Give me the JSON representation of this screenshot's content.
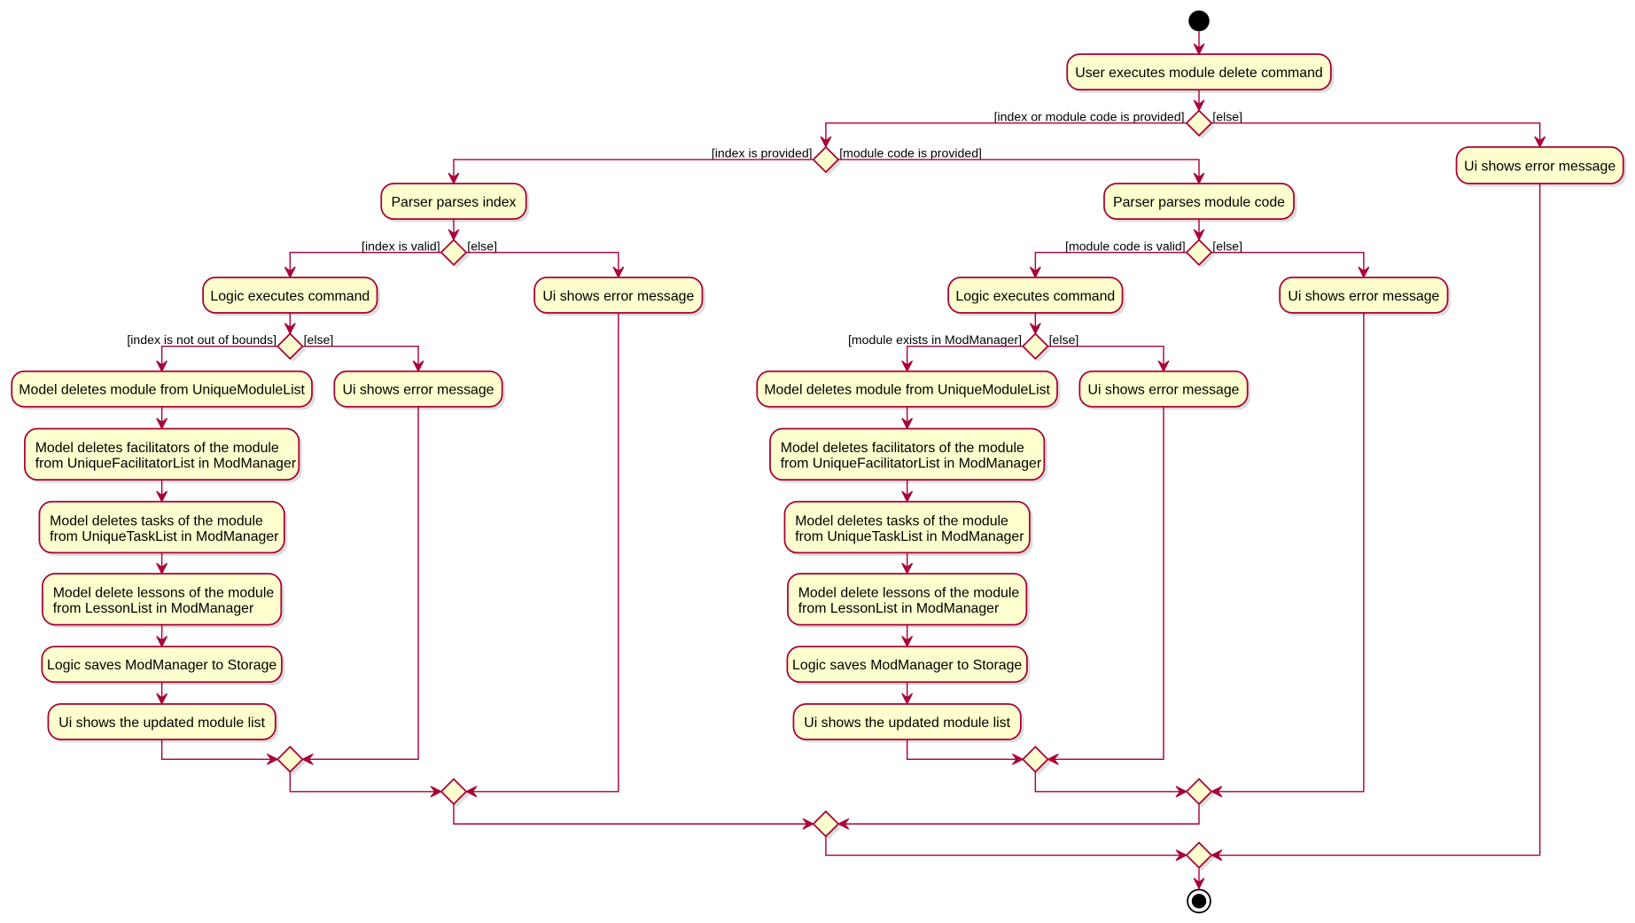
{
  "diagram": {
    "start_action": "User executes module delete command",
    "guards": {
      "provided": "[index or module code is provided]",
      "else_top": "[else]",
      "index_provided": "[index is provided]",
      "module_code_provided": "[module code is provided]"
    },
    "top_error": "Ui shows error message",
    "colors": {
      "fill": "#FEFECE",
      "stroke": "#A80036"
    }
  },
  "left_branch": {
    "parse": "Parser parses index",
    "guard_valid": "[index is valid]",
    "guard_invalid": "[else]",
    "logic": "Logic executes command",
    "error1": "Ui shows error message",
    "guard_ok": "[index is not out of bounds]",
    "guard_not_ok": "[else]",
    "error2": "Ui shows error message",
    "delete_module": "Model deletes module from UniqueModuleList",
    "facilitators": [
      "Model deletes facilitators of the module",
      "from UniqueFacilitatorList in ModManager"
    ],
    "tasks": [
      "Model deletes tasks of the module",
      "from UniqueTaskList in ModManager"
    ],
    "lessons": [
      "Model delete lessons of the module",
      "from LessonList in ModManager"
    ],
    "save": "Logic saves ModManager to Storage",
    "ui_update": "Ui shows the updated module list"
  },
  "right_branch": {
    "parse": "Parser parses module code",
    "guard_valid": "[module code is valid]",
    "guard_invalid": "[else]",
    "logic": "Logic executes command",
    "error1": "Ui shows error message",
    "guard_ok": "[module exists in ModManager]",
    "guard_not_ok": "[else]",
    "error2": "Ui shows error message",
    "delete_module": "Model deletes module from UniqueModuleList",
    "facilitators": [
      "Model deletes facilitators of the module",
      "from UniqueFacilitatorList in ModManager"
    ],
    "tasks": [
      "Model deletes tasks of the module",
      "from UniqueTaskList in ModManager"
    ],
    "lessons": [
      "Model delete lessons of the module",
      "from LessonList in ModManager"
    ],
    "save": "Logic saves ModManager to Storage",
    "ui_update": "Ui shows the updated module list"
  }
}
